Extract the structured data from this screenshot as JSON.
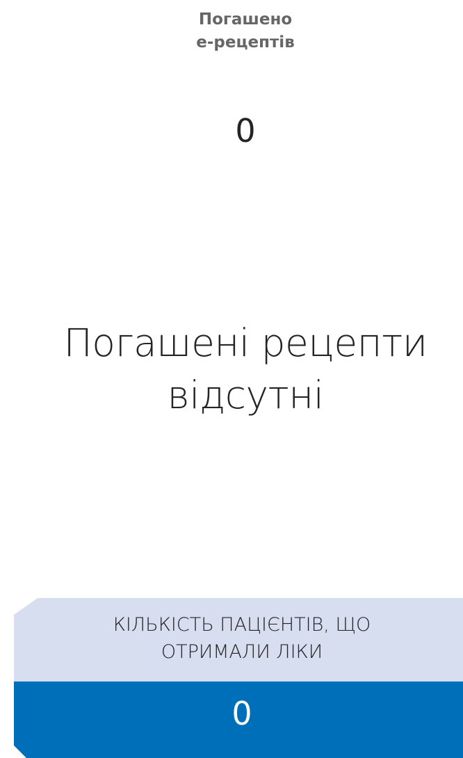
{
  "header": {
    "title_line1": "Погашено",
    "title_line2": "е-рецептів",
    "count": "0"
  },
  "main": {
    "empty_line1": "Погашені рецепти",
    "empty_line2": "відсутні"
  },
  "patients_card": {
    "label_line1": "КІЛЬКІСТЬ ПАЦІЄНТІВ, ЩО",
    "label_line2": "ОТРИМАЛИ ЛІКИ",
    "value": "0"
  },
  "colors": {
    "card_top_bg": "#d6def0",
    "card_bottom_bg": "#006fb9",
    "header_text": "#666666",
    "main_text": "#252423"
  }
}
